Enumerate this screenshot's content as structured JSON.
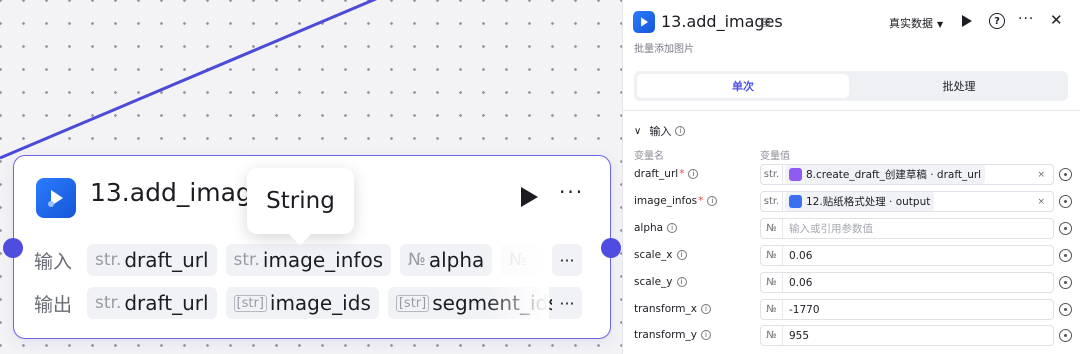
{
  "node": {
    "title": "13.add_images",
    "input_label": "输入",
    "output_label": "输出",
    "inputs": [
      {
        "type": "str.",
        "name": "draft_url"
      },
      {
        "type": "str.",
        "name": "image_infos"
      },
      {
        "type": "№",
        "name": "alpha"
      },
      {
        "type": "№",
        "name": ""
      }
    ],
    "outputs": [
      {
        "type": "str.",
        "name": "draft_url"
      },
      {
        "type": "[str]",
        "name": "image_ids"
      },
      {
        "type": "[str]",
        "name": "segment_ids"
      }
    ],
    "more": "···",
    "tooltip": "String"
  },
  "panel": {
    "title": "13.add_images",
    "subtitle": "批量添加图片",
    "mode": "真实数据",
    "more": "···",
    "close": "✕",
    "tabs": [
      "单次",
      "批处理"
    ],
    "section": "输入",
    "col_name": "变量名",
    "col_value": "变量值",
    "params": [
      {
        "name": "draft_url",
        "required": "*",
        "type": "str.",
        "ref_icon": "#8e5cf0",
        "value": "8.create_draft_创建草稿 · draft_url",
        "clear": "×"
      },
      {
        "name": "image_infos",
        "required": "*",
        "type": "str.",
        "ref_icon": "#3a6ff0",
        "value": "12.贴纸格式处理 · output",
        "clear": "×"
      },
      {
        "name": "alpha",
        "required": "",
        "type": "№",
        "placeholder": "输入或引用参数值"
      },
      {
        "name": "scale_x",
        "required": "",
        "type": "№",
        "value": "0.06"
      },
      {
        "name": "scale_y",
        "required": "",
        "type": "№",
        "value": "0.06"
      },
      {
        "name": "transform_x",
        "required": "",
        "type": "№",
        "value": "-1770"
      },
      {
        "name": "transform_y",
        "required": "",
        "type": "№",
        "value": "955"
      }
    ]
  },
  "colors": {
    "accent": "#4d53e8",
    "port": "#4f4ce0",
    "edge": "#4b4bd8"
  }
}
